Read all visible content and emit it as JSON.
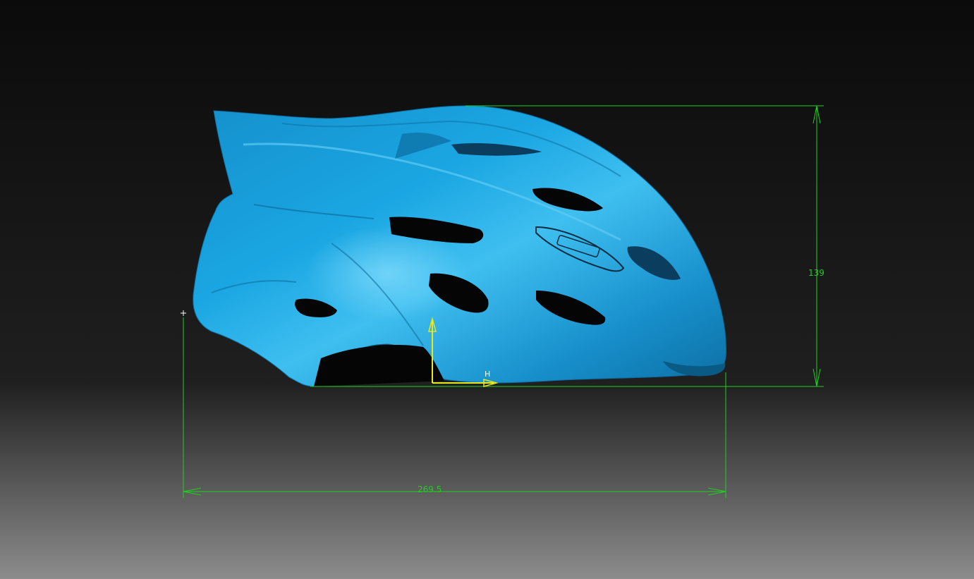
{
  "viewport": {
    "background_top_color": "#0b0b0b",
    "background_horizon_color": "#1f1f1f",
    "background_bottom_color": "#8c8c8c"
  },
  "model": {
    "color": "#1aa3df",
    "highlight_color": "#6fd6ff",
    "shadow_color": "#0a5f8c"
  },
  "dimensions": {
    "color": "#1fd01f",
    "height_value": "139",
    "length_value": "269.5"
  },
  "axes": {
    "color": "#e8e81a",
    "horizontal_label": "H"
  }
}
